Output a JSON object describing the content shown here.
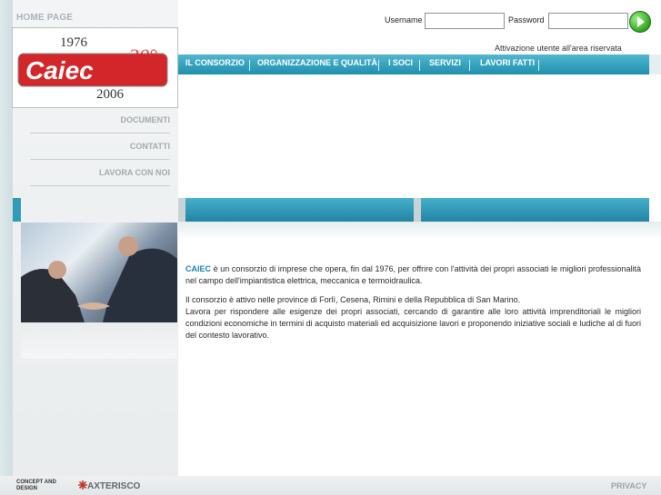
{
  "sidebar": {
    "home_label": "HOME PAGE",
    "logo": {
      "year_top": "1976",
      "name": "Caiec",
      "anniversary": "30°",
      "year_bottom": "2006"
    },
    "items": [
      {
        "label": "DOCUMENTI"
      },
      {
        "label": "CONTATTI"
      },
      {
        "label": "LAVORA CON NOI"
      }
    ]
  },
  "login": {
    "username_label": "Username",
    "password_label": "Password",
    "username_value": "",
    "password_value": "",
    "activation_text": "Attivazione utente all'area riservata"
  },
  "nav": {
    "items": [
      {
        "label": "IL CONSORZIO"
      },
      {
        "label": "ORGANIZZAZIONE E QUALITÀ"
      },
      {
        "label": "I SOCI"
      },
      {
        "label": "SERVIZI"
      },
      {
        "label": "LAVORI FATTI"
      }
    ]
  },
  "main": {
    "brand": "CAIEC",
    "p1_rest": " è un consorzio di imprese che opera, fin dal 1976, per offrire con l'attività dei propri associati le migliori professionalità nel campo dell'impiantistica elettrica, meccanica e termoidraulica.",
    "p2_line1": "Il consorzio è attivo nelle province di Forlì, Cesena, Rimini e della Repubblica di San Marino.",
    "p2_line2": "Lavora per rispondere alle esigenze dei propri associati, cercando di garantire alle loro attività imprenditoriali le migliori condizioni economiche in termini di acquisto materiali ed acquisizione lavori e proponendo iniziative sociali e ludiche al di fuori del contesto lavorativo."
  },
  "footer": {
    "concept_line1": "CONCEPT AND",
    "concept_line2": "DESIGN",
    "agency": "AXTERISCO",
    "privacy": "PRIVACY"
  },
  "colors": {
    "accent": "#2f9bb8",
    "brand_red": "#d2262b",
    "go_green": "#2fa51d"
  }
}
